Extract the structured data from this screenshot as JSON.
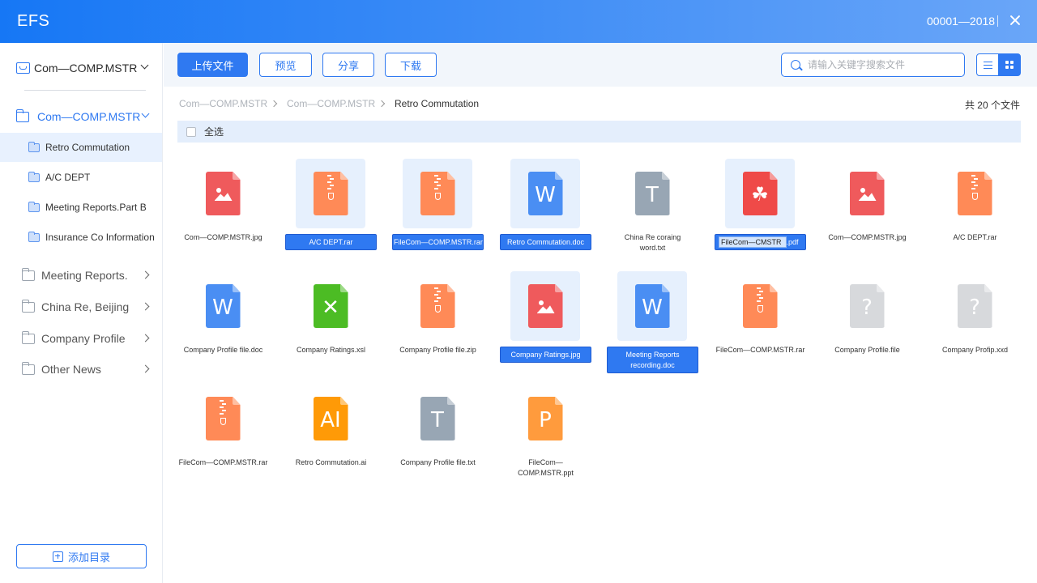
{
  "header": {
    "brand": "EFS",
    "id_text": "00001—2018"
  },
  "sidebar": {
    "workspace": "Com—COMP.MSTR",
    "active_folder": "Com—COMP.MSTR",
    "subfolders": [
      "Retro Commutation",
      "A/C DEPT",
      "Meeting Reports.Part B",
      "Insurance Co Information"
    ],
    "groups": [
      "Meeting Reports.",
      "China Re, Beijing",
      "Company Profile",
      "Other News"
    ],
    "add_label": "添加目录"
  },
  "toolbar": {
    "upload": "上传文件",
    "preview": "预览",
    "share": "分享",
    "download": "下载",
    "search_placeholder": "请输入关键字搜索文件"
  },
  "breadcrumb": [
    "Com—COMP.MSTR",
    "Com—COMP.MSTR",
    "Retro Commutation"
  ],
  "file_count": "共 20 个文件",
  "select_all": "全选",
  "files": [
    {
      "name": "Com—COMP.MSTR.jpg",
      "type": "img"
    },
    {
      "name": "A/C DEPT.rar",
      "type": "zip"
    },
    {
      "name": "FileCom—COMP.MSTR.rar",
      "type": "zip"
    },
    {
      "name": "Retro Commutation.doc",
      "type": "word",
      "letter": "W"
    },
    {
      "name": "China Re coraing word.txt",
      "type": "txt",
      "letter": "T"
    },
    {
      "name": "FileCom—CMSTR",
      "ext": ".pdf",
      "type": "pdf"
    },
    {
      "name": "Com—COMP.MSTR.jpg",
      "type": "img"
    },
    {
      "name": "A/C DEPT.rar",
      "type": "zip"
    },
    {
      "name": "Company Profile file.doc",
      "type": "word",
      "letter": "W"
    },
    {
      "name": "Company Ratings.xsl",
      "type": "xls",
      "letter": "✕"
    },
    {
      "name": "Company Profile file.zip",
      "type": "zip"
    },
    {
      "name": "Company Ratings.jpg",
      "type": "img"
    },
    {
      "name": "Meeting Reports recording.doc",
      "type": "word",
      "letter": "W"
    },
    {
      "name": "FileCom—COMP.MSTR.rar",
      "type": "zip"
    },
    {
      "name": "Company Profile.file",
      "type": "unk",
      "letter": "?"
    },
    {
      "name": "Company Profip.xxd",
      "type": "unk",
      "letter": "?"
    },
    {
      "name": "FileCom—COMP.MSTR.rar",
      "type": "zip"
    },
    {
      "name": "Retro Commutation.ai",
      "type": "ai",
      "letter": "AI"
    },
    {
      "name": "Company Profile file.txt",
      "type": "txt",
      "letter": "T"
    },
    {
      "name": "FileCom—COMP.MSTR.ppt",
      "type": "ppt",
      "letter": "P"
    }
  ],
  "colors": {
    "accent": "#2f79f1",
    "selected_bg": "#e6f0fd"
  }
}
